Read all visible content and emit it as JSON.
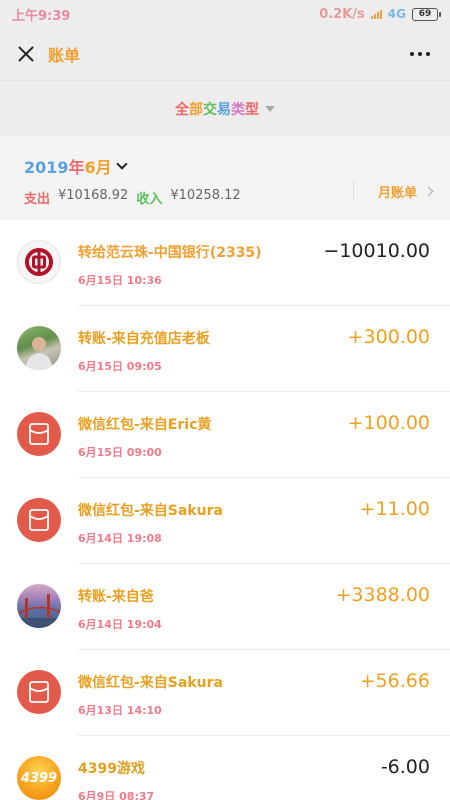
{
  "status_bar": {
    "time": "上午9:39",
    "net_speed": "0.2K/s",
    "network_type": "4G",
    "battery": "69"
  },
  "nav": {
    "title": "账单",
    "close_icon": "close-icon",
    "more_icon": "more-icon"
  },
  "filter": {
    "label": "全部交易类型",
    "caret_icon": "caret-down-icon"
  },
  "summary": {
    "month": "2019年6月",
    "expense_label": "支出",
    "expense_value": "¥10168.92",
    "income_label": "收入",
    "income_value": "¥10258.12",
    "monthly_bill_label": "月账单"
  },
  "colors": {
    "background": "#ededed",
    "accent_orange": "#f0a020",
    "red_packet": "#e25a4a",
    "time_pink": "#f07a8a"
  },
  "transactions": [
    {
      "icon": "bank-of-china-icon",
      "title": "转给范云珠-中国银行(2335)",
      "time": "6月15日 10:36",
      "amount": "−10010.00",
      "direction": "out"
    },
    {
      "icon": "user-avatar",
      "title": "转账-来自充值店老板",
      "time": "6月15日 09:05",
      "amount": "+300.00",
      "direction": "in"
    },
    {
      "icon": "red-packet-icon",
      "title": "微信红包-来自Eric黄",
      "time": "6月15日 09:00",
      "amount": "+100.00",
      "direction": "in"
    },
    {
      "icon": "red-packet-icon",
      "title": "微信红包-来自Sakura",
      "time": "6月14日 19:08",
      "amount": "+11.00",
      "direction": "in"
    },
    {
      "icon": "user-avatar",
      "title": "转账-来自爸",
      "time": "6月14日 19:04",
      "amount": "+3388.00",
      "direction": "in"
    },
    {
      "icon": "red-packet-icon",
      "title": "微信红包-来自Sakura",
      "time": "6月13日 14:10",
      "amount": "+56.66",
      "direction": "in"
    },
    {
      "icon": "game-4399-icon",
      "title": "4399游戏",
      "time": "6月9日 08:37",
      "amount": "-6.00",
      "direction": "out",
      "logo_text": "4399"
    }
  ]
}
